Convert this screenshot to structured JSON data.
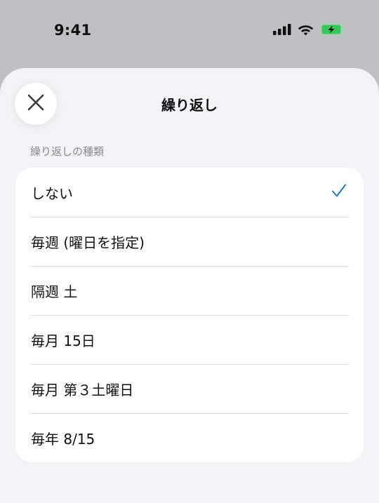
{
  "status_bar": {
    "time": "9:41",
    "icons": [
      "signal-icon",
      "wifi-icon",
      "battery-charging-icon"
    ],
    "battery_color": "#34c759"
  },
  "sheet": {
    "title": "繰り返し",
    "close_icon": "close-icon",
    "section_header": "繰り返しの種類",
    "options": [
      {
        "label": "しない",
        "selected": true
      },
      {
        "label": "毎週 (曜日を指定)",
        "selected": false
      },
      {
        "label": "隔週 土",
        "selected": false
      },
      {
        "label": "毎月 15日",
        "selected": false
      },
      {
        "label": "毎月 第３土曜日",
        "selected": false
      },
      {
        "label": "毎年 8/15",
        "selected": false
      }
    ],
    "check_icon": "checkmark-icon",
    "accent_color": "#1e7ad1"
  }
}
